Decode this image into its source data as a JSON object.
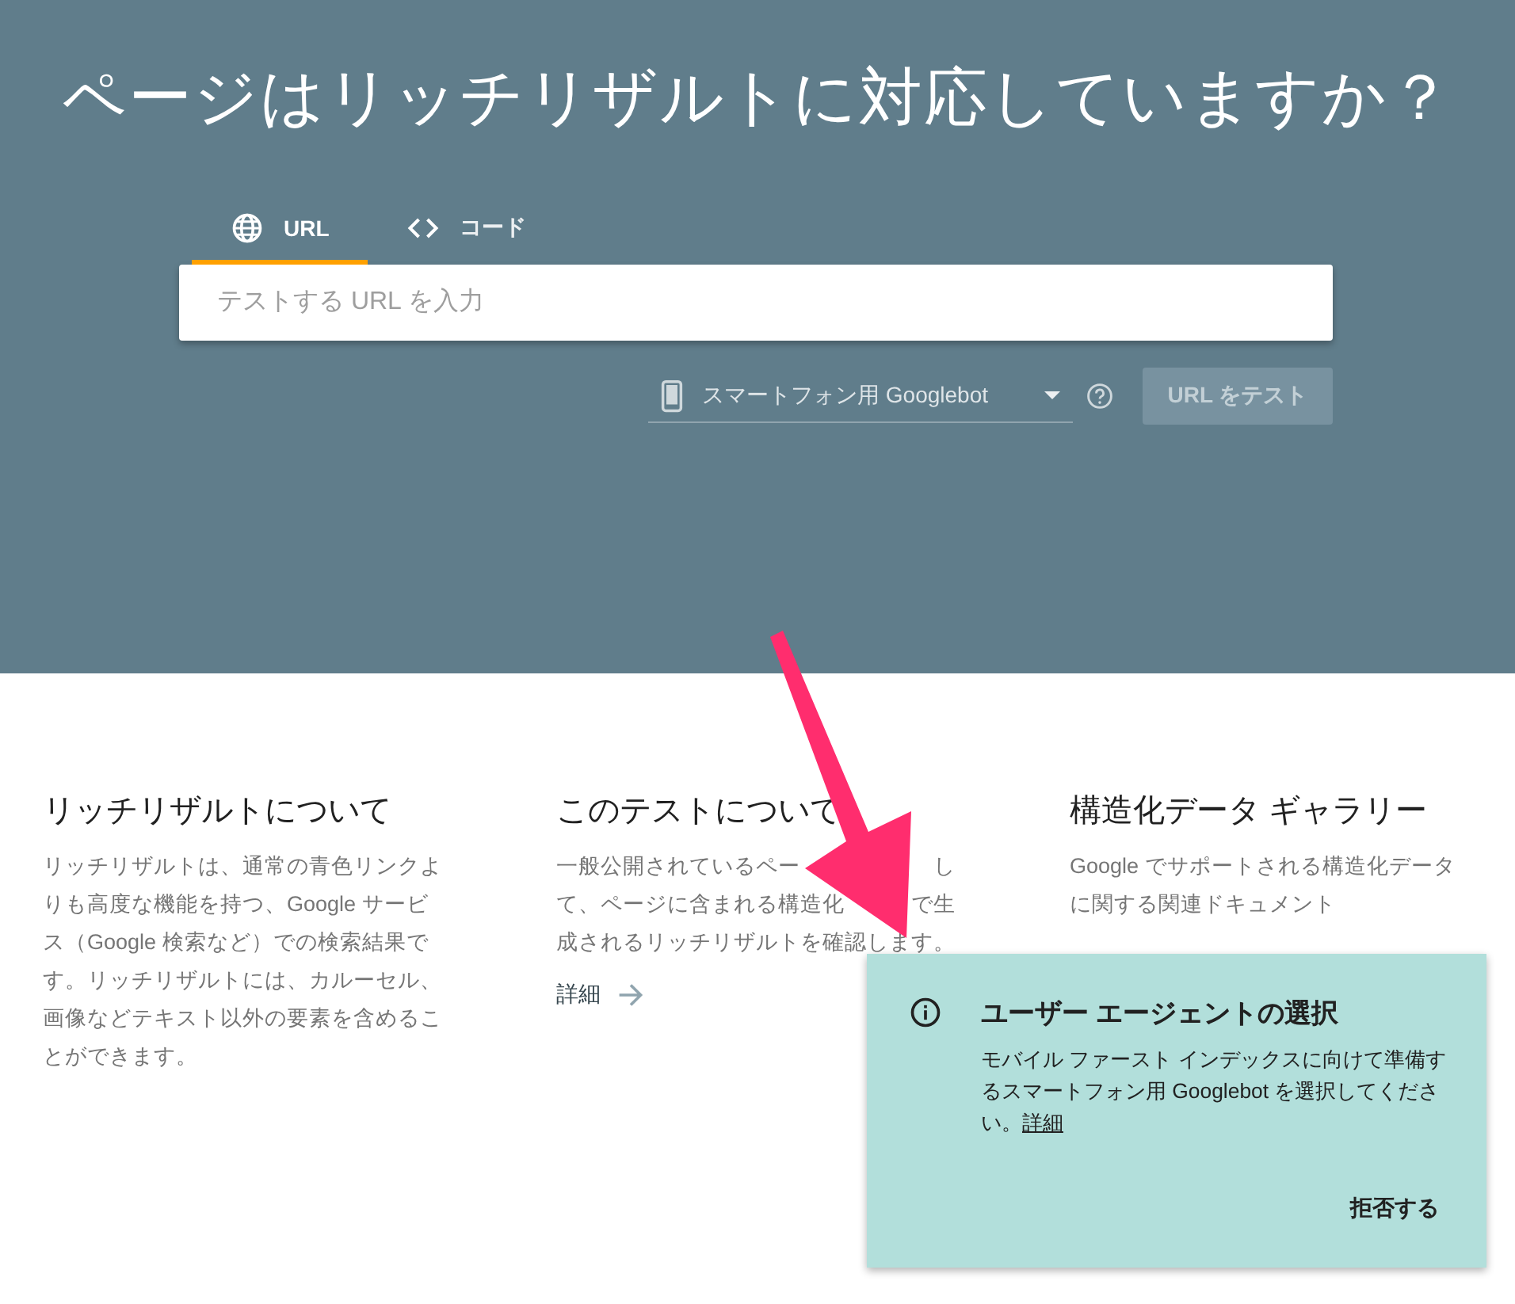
{
  "title": "ページはリッチリザルトに対応していますか？",
  "tabs": [
    {
      "label": "URL",
      "selected": true
    },
    {
      "label": "コード",
      "selected": false
    }
  ],
  "url_field": {
    "placeholder": "テストする URL を入力"
  },
  "user_agent": {
    "value": "スマートフォン用 Googlebot"
  },
  "test_button": {
    "label": "URL をテスト",
    "disabled": true
  },
  "info_columns": [
    {
      "title": "リッチリザルトについて",
      "body_lines": [
        [
          "リッチリザルトは、通常の青色リンクよ"
        ],
        [
          "りも高度な機能を持つ、Google サービ"
        ],
        [
          "ス（Google 検索など）での検索結果で"
        ],
        [
          "す。リッチリザルトには、カルーセル、"
        ],
        [
          "画像などテキスト以外の要素を含めるこ"
        ],
        [
          "とができます。"
        ]
      ]
    },
    {
      "title": "このテストについて",
      "body_lines": [
        [
          "一般公開されているペー",
          "し"
        ],
        [
          "て、ページに含まれる構造化",
          "で生"
        ],
        [
          "成されるリッチリザルトを確認します。"
        ]
      ],
      "link": "詳細"
    },
    {
      "title": "構造化データ ギャラリー",
      "body_lines": [
        [
          "Google でサポートされる構造化データ"
        ],
        [
          "に関する関連ドキュメント"
        ]
      ]
    }
  ],
  "toast": {
    "title": "ユーザー エージェントの選択",
    "body": "モバイル ファースト インデックスに向けて準備するスマートフォン用 Googlebot を選択してください。",
    "link": "詳細",
    "dismiss": "拒否する"
  }
}
